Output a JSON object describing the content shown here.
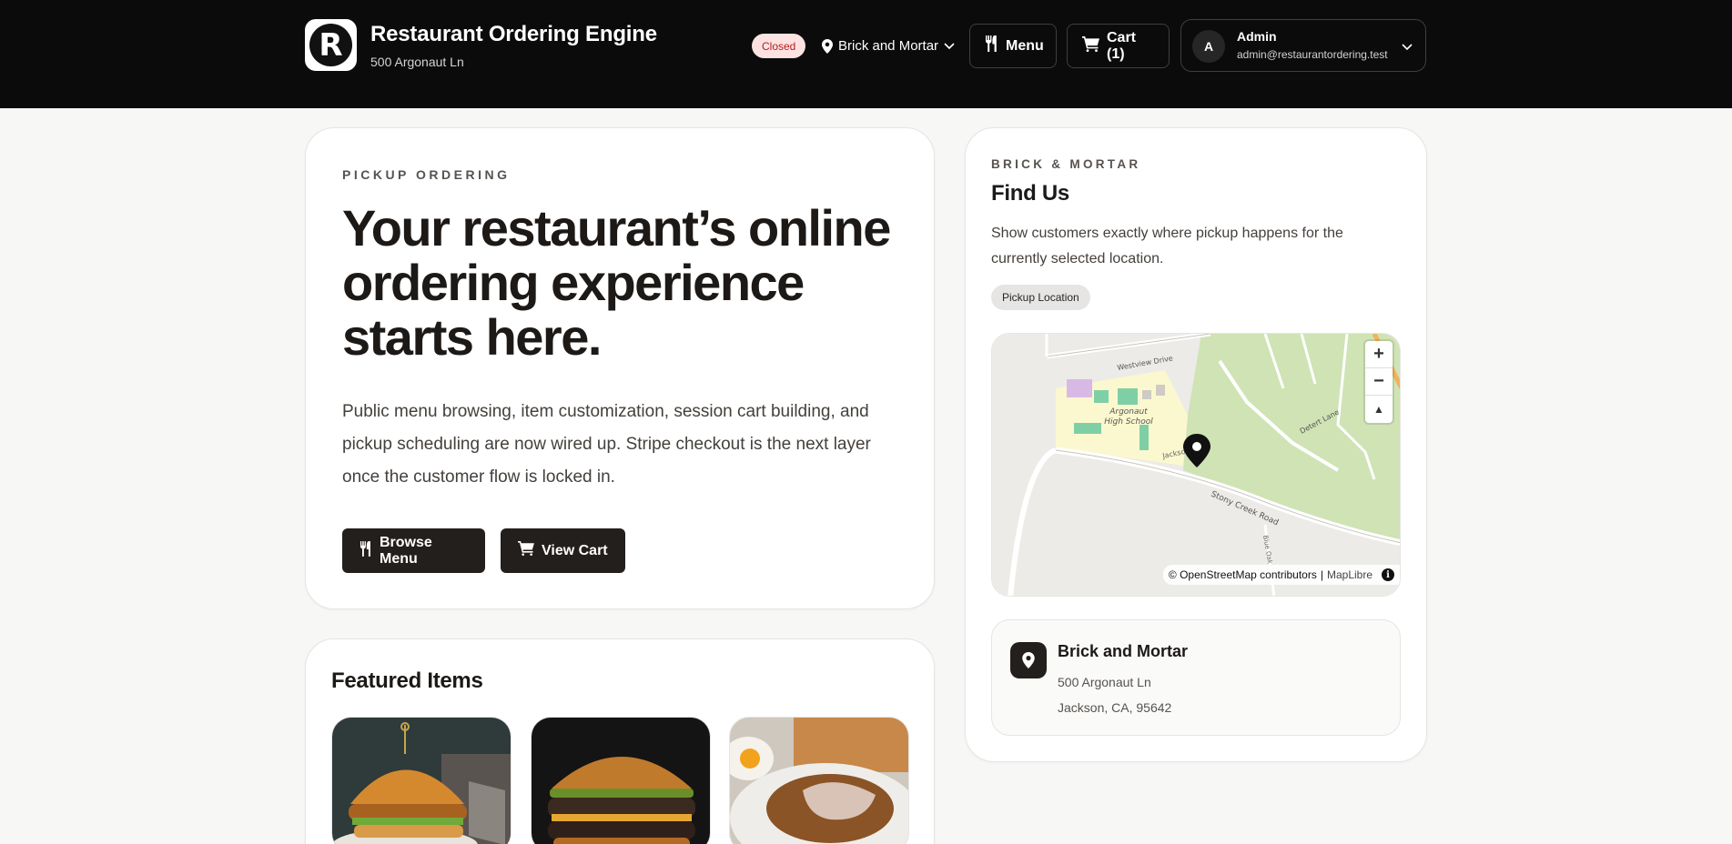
{
  "header": {
    "brand_letter": "R",
    "title": "Restaurant Ordering Engine",
    "address": "500 Argonaut Ln",
    "status": "Closed",
    "location_select": "Brick and Mortar",
    "menu_label": "Menu",
    "cart_label": "Cart (1)",
    "user": {
      "initial": "A",
      "name": "Admin",
      "email": "admin@restaurantordering.test"
    }
  },
  "hero": {
    "eyebrow": "PICKUP ORDERING",
    "title": "Your restaurant’s online ordering experience starts here.",
    "body": "Public menu browsing, item customization, session cart building, and pickup scheduling are now wired up. Stripe checkout is the next layer once the customer flow is locked in.",
    "browse_label": "Browse Menu",
    "view_cart_label": "View Cart"
  },
  "featured": {
    "title": "Featured Items"
  },
  "find_us": {
    "eyebrow": "BRICK & MORTAR",
    "title": "Find Us",
    "body": "Show customers exactly where pickup happens for the currently selected location.",
    "badge": "Pickup Location",
    "map": {
      "attribution": "© OpenStreetMap contributors",
      "attribution_sep": "|",
      "attribution_lib": "MapLibre",
      "zoom_in": "+",
      "zoom_out": "−",
      "compass": "▲",
      "info": "i",
      "labels": {
        "school": "Argonaut",
        "school2": "High School",
        "road1": "Stony Creek Road",
        "road2": "Westview Drive",
        "road3": "Jackson",
        "road4": "Detert Lane",
        "road5": "Blue Oak"
      }
    },
    "location": {
      "name": "Brick and Mortar",
      "line1": "500 Argonaut Ln",
      "line2": "Jackson, CA, 95642"
    }
  },
  "colors": {
    "header_bg": "#0b0b0b",
    "accent_dark": "#231f1d",
    "status_bg": "#fde2e2",
    "status_text": "#b91c1c",
    "page_bg": "#f7f7f6"
  }
}
